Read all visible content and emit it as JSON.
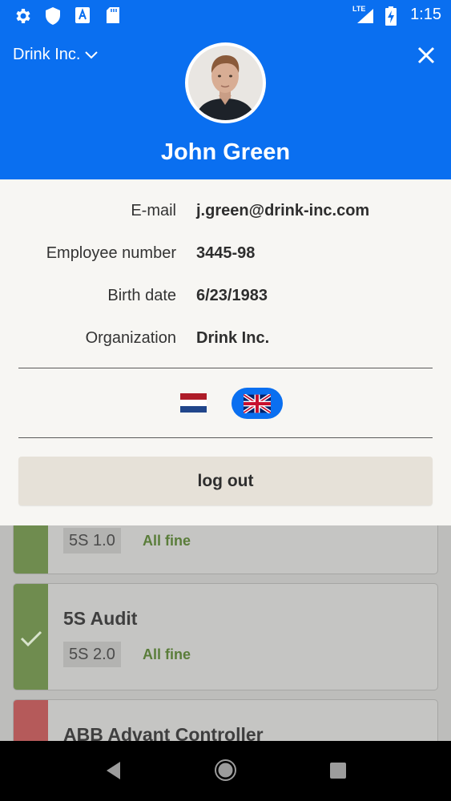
{
  "status_bar": {
    "time": "1:15",
    "left_icons": [
      "gear-icon",
      "shield-icon",
      "a-box-icon",
      "sd-card-icon"
    ],
    "right_icons": [
      "lte-signal-icon",
      "battery-charging-icon"
    ],
    "lte_label": "LTE"
  },
  "header": {
    "organization": "Drink Inc.",
    "user_name": "John Green",
    "background_color": "#0a6ff0"
  },
  "profile": {
    "fields": [
      {
        "label": "E-mail",
        "value": "j.green@drink-inc.com"
      },
      {
        "label": "Employee number",
        "value": "3445-98"
      },
      {
        "label": "Birth date",
        "value": "6/23/1983"
      },
      {
        "label": "Organization",
        "value": "Drink Inc."
      }
    ],
    "languages": [
      {
        "name": "Dutch",
        "icon": "netherlands-flag-icon",
        "selected": false
      },
      {
        "name": "English",
        "icon": "uk-flag-icon",
        "selected": true
      }
    ],
    "logout_label": "log out"
  },
  "background_list": {
    "items": [
      {
        "title": "",
        "version": "5S 1.0",
        "status": "All fine",
        "status_color": "green"
      },
      {
        "title": "5S Audit",
        "version": "5S 2.0",
        "status": "All fine",
        "status_color": "green"
      },
      {
        "title": "ABB Advant Controller",
        "version": "",
        "status": "",
        "status_color": "red"
      }
    ]
  },
  "nav_bar": {
    "buttons": [
      "back-icon",
      "home-icon",
      "recents-icon"
    ]
  }
}
